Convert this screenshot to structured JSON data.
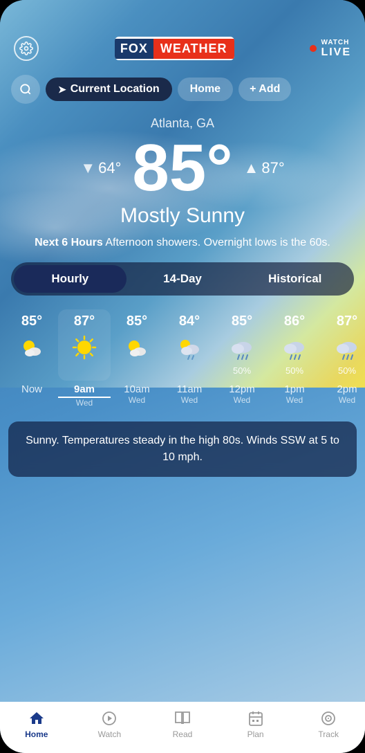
{
  "app": {
    "title": "Fox Weather"
  },
  "header": {
    "logo_fox": "FOX",
    "logo_weather": "WEATHER",
    "watch_label": "WATCH",
    "live_label": "LIVE",
    "gear_icon": "⚙"
  },
  "search_bar": {
    "search_icon": "🔍",
    "current_location_label": "Current Location",
    "home_label": "Home",
    "add_label": "+ Add"
  },
  "weather": {
    "city": "Atlanta, GA",
    "temp_main": "85°",
    "temp_low": "64°",
    "temp_high": "87°",
    "condition": "Mostly Sunny",
    "forecast_bold": "Next 6 Hours",
    "forecast_text": " Afternoon showers. Overnight lows is the 60s."
  },
  "tabs": [
    {
      "id": "hourly",
      "label": "Hourly",
      "active": true
    },
    {
      "id": "14day",
      "label": "14-Day",
      "active": false
    },
    {
      "id": "historical",
      "label": "Historical",
      "active": false
    }
  ],
  "hourly": [
    {
      "time": "Now",
      "sub": "",
      "temp": "85°",
      "icon": "sun_cloud",
      "precip": ""
    },
    {
      "time": "9am",
      "sub": "Wed",
      "temp": "87°",
      "icon": "sun_bright",
      "precip": "",
      "active": true
    },
    {
      "time": "10am",
      "sub": "Wed",
      "temp": "85°",
      "icon": "sun_cloud",
      "precip": ""
    },
    {
      "time": "11am",
      "sub": "Wed",
      "temp": "84°",
      "icon": "sun_cloud_rain",
      "precip": ""
    },
    {
      "time": "12pm",
      "sub": "Wed",
      "temp": "85°",
      "icon": "cloud_rain",
      "precip": "50%"
    },
    {
      "time": "1pm",
      "sub": "Wed",
      "temp": "86°",
      "icon": "cloud_rain",
      "precip": "50%"
    },
    {
      "time": "2pm",
      "sub": "Wed",
      "temp": "87°",
      "icon": "cloud_rain",
      "precip": "50%"
    }
  ],
  "bottom_description": "Sunny. Temperatures steady in the high 80s. Winds SSW at 5 to 10 mph.",
  "nav": [
    {
      "id": "home",
      "label": "Home",
      "icon": "home",
      "active": true
    },
    {
      "id": "watch",
      "label": "Watch",
      "icon": "play",
      "active": false
    },
    {
      "id": "read",
      "label": "Read",
      "icon": "book",
      "active": false
    },
    {
      "id": "plan",
      "label": "Plan",
      "icon": "calendar",
      "active": false
    },
    {
      "id": "track",
      "label": "Track",
      "icon": "target",
      "active": false
    }
  ]
}
